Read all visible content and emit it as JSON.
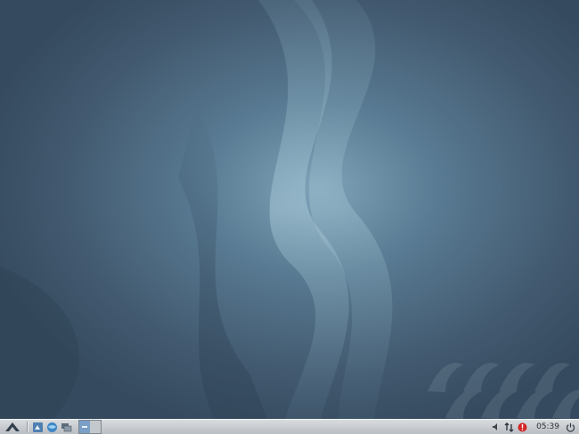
{
  "desktop": {
    "wallpaper": {
      "base_color": "#3f566c",
      "highlight_color": "#9fc4d6"
    }
  },
  "taskbar": {
    "start_icon": "zorin-start-icon",
    "launchers": [
      {
        "icon": "file-manager-icon"
      },
      {
        "icon": "browser-icon"
      },
      {
        "icon": "show-desktop-icon"
      }
    ],
    "pager": {
      "desktops": 2,
      "active_index": 0
    },
    "tray": [
      {
        "icon": "volume-icon"
      },
      {
        "icon": "network-icon"
      },
      {
        "icon": "update-alert-icon",
        "color": "#d42626"
      }
    ],
    "clock": "05:39",
    "power_icon": "power-icon"
  }
}
